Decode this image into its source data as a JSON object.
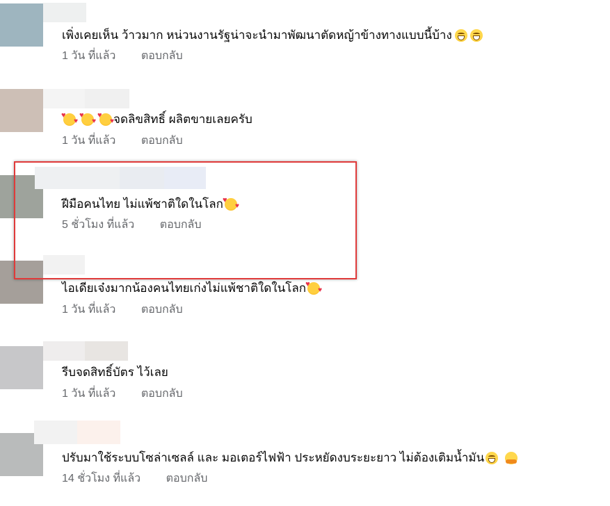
{
  "comments": [
    {
      "text": "เพิ่งเคยเห็น ว้าวมาก หน่วนงานรัฐน่าจะนำมาพัฒนาตัดหญ้าข้างทางแบบนี้บ้าง",
      "emojis": [
        "grin",
        "grin"
      ],
      "time": "1 วัน ที่แล้ว",
      "reply": "ตอบกลับ",
      "avatar_color": "#9eb5bf"
    },
    {
      "text": "จดลิขสิทธิ์ ผลิตขายเลยครับ",
      "emojis_before": [
        "love",
        "love",
        "love"
      ],
      "time": "1 วัน ที่แล้ว",
      "reply": "ตอบกลับ",
      "avatar_color": "#cdbfb6"
    },
    {
      "text": "ฝีมือคนไทย ไม่แพ้ชาติใดในโลก",
      "emojis": [
        "love"
      ],
      "time": "5 ชั่วโมง ที่แล้ว",
      "reply": "ตอบกลับ",
      "avatar_color": "#9ea39c",
      "highlighted": true
    },
    {
      "text": "ไอเดียเจ๋งมากน้องคนไทยเก่งไม่แพ้ชาติใดในโลก",
      "emojis": [
        "love"
      ],
      "time": "1 วัน ที่แล้ว",
      "reply": "ตอบกลับ",
      "avatar_color": "#a59f9a"
    },
    {
      "text": "รีบจดสิทธิ์บัตร ไว้เลย",
      "emojis": [],
      "time": "1 วัน ที่แล้ว",
      "reply": "ตอบกลับ",
      "avatar_color": "#c7c7c9"
    },
    {
      "text": "ปรับมาใช้ระบบโซล่าเซลล์ และ มอเตอร์ไฟฟ้า ประหยัดงบระยะยาว ไม่ต้องเติมน้ำมัน",
      "emojis": [
        "grin",
        "hug"
      ],
      "time": "14 ชั่วโมง ที่แล้ว",
      "reply": "ตอบกลับ",
      "avatar_color": "#b9bbbb"
    }
  ],
  "colors": {
    "highlight_border": "#e03a3a",
    "meta_text": "#65676b",
    "comment_text": "#050505"
  }
}
